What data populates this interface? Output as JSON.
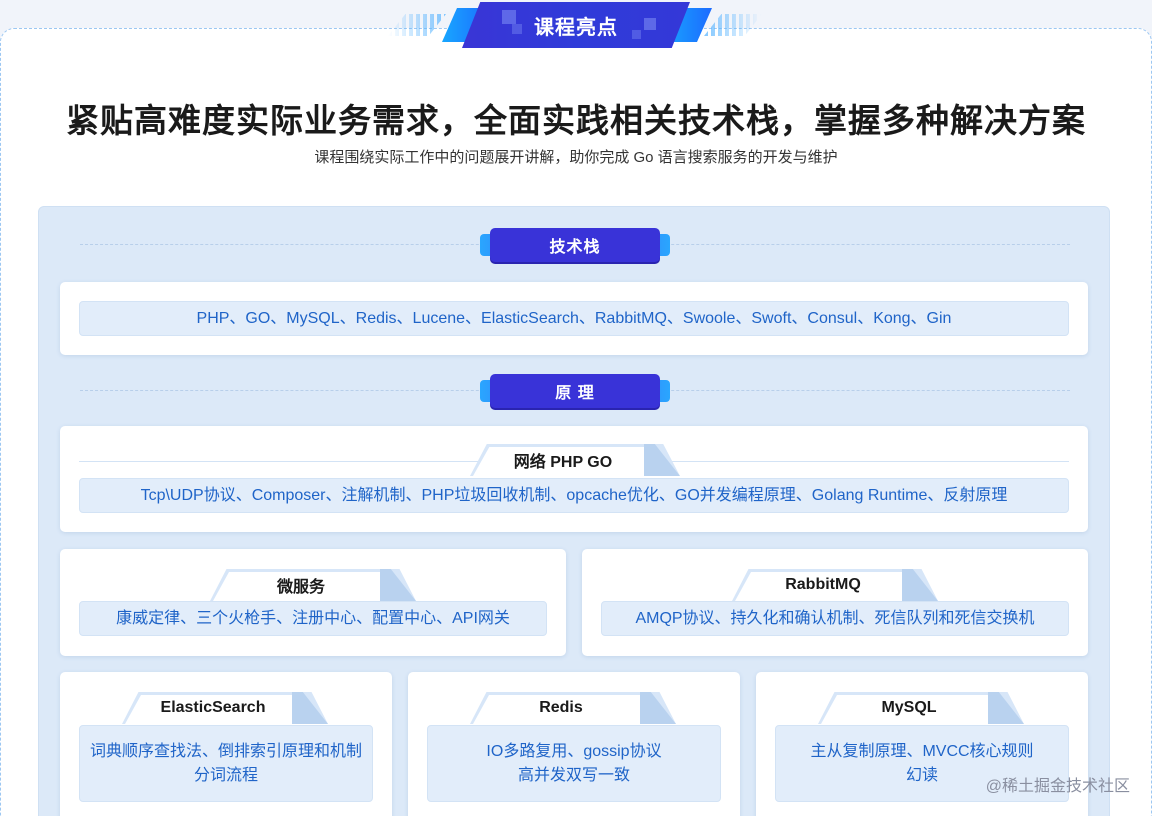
{
  "ribbon": {
    "title": "课程亮点"
  },
  "headline": "紧贴高难度实际业务需求，全面实践相关技术栈，掌握多种解决方案",
  "subline": "课程围绕实际工作中的问题展开讲解，助你完成 Go 语言搜索服务的开发与维护",
  "sections": {
    "tech_stack": {
      "label": "技术栈",
      "content": "PHP、GO、MySQL、Redis、Lucene、ElasticSearch、RabbitMQ、Swoole、Swoft、Consul、Kong、Gin"
    },
    "principles": {
      "label": "原 理"
    }
  },
  "cards": {
    "network": {
      "title": "网络 PHP GO",
      "content": "Tcp\\UDP协议、Composer、注解机制、PHP垃圾回收机制、opcache优化、GO并发编程原理、Golang Runtime、反射原理"
    },
    "microservice": {
      "title": "微服务",
      "content": "康威定律、三个火枪手、注册中心、配置中心、API网关"
    },
    "rabbitmq": {
      "title": "RabbitMQ",
      "content": "AMQP协议、持久化和确认机制、死信队列和死信交换机"
    },
    "elasticsearch": {
      "title": "ElasticSearch",
      "line1": "词典顺序查找法、倒排索引原理和机制",
      "line2": "分词流程"
    },
    "redis": {
      "title": "Redis",
      "line1": "IO多路复用、gossip协议",
      "line2": "高并发双写一致"
    },
    "mysql": {
      "title": "MySQL",
      "line1": "主从复制原理、MVCC核心规则",
      "line2": "幻读"
    }
  },
  "watermark": "@稀土掘金技术社区",
  "colors": {
    "accent": "#3933d8",
    "link_blue": "#1f64c8",
    "panel_bg": "#dce9f8"
  }
}
